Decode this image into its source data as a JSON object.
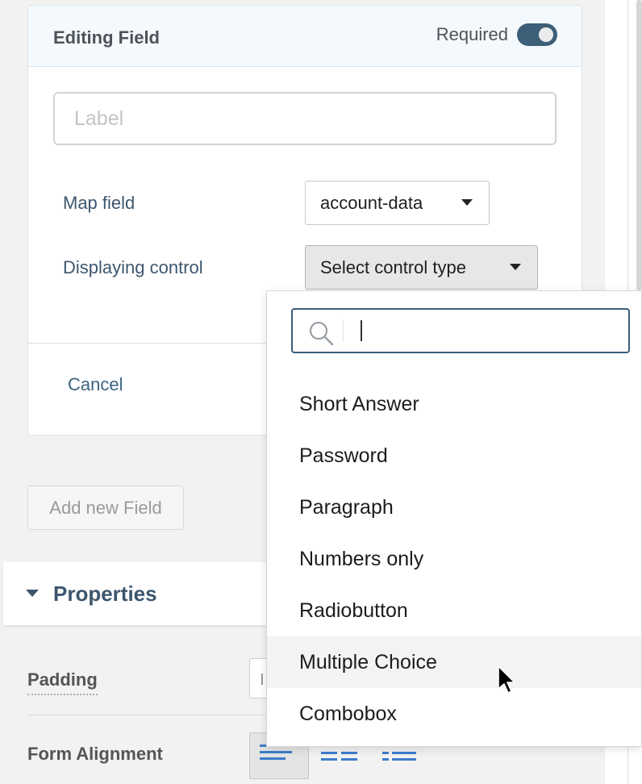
{
  "editing_card": {
    "title": "Editing Field",
    "required_label": "Required",
    "required_on": true,
    "label_placeholder": "Label",
    "label_value": "",
    "map_field_label": "Map field",
    "map_field_value": "account-data",
    "displaying_control_label": "Displaying control",
    "control_type_placeholder": "Select control type",
    "cancel_label": "Cancel"
  },
  "add_field_label": "Add new Field",
  "properties": {
    "title": "Properties",
    "padding_label": "Padding",
    "form_alignment_label": "Form Alignment"
  },
  "dropdown": {
    "search_value": "",
    "options": [
      "Short Answer",
      "Password",
      "Paragraph",
      "Numbers only",
      "Radiobutton",
      "Multiple Choice",
      "Combobox"
    ],
    "hovered_option": "Multiple Choice"
  },
  "colors": {
    "accent": "#3d566e",
    "toggle": "#3d5f78",
    "align_icon": "#3b7cc9"
  }
}
